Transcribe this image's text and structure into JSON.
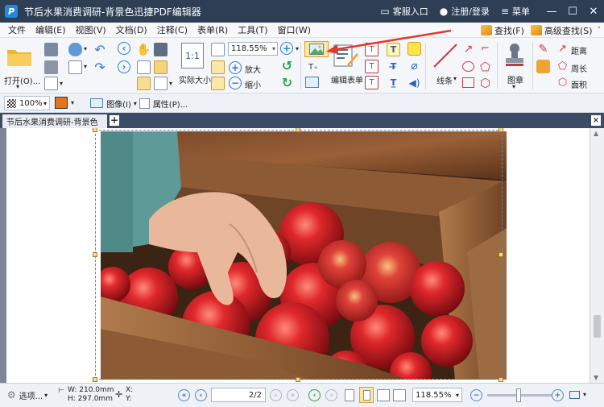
{
  "titlebar": {
    "app_icon": "P",
    "title": "节后水果消费调研-背景色迅捷PDF编辑器",
    "links": [
      {
        "icon": "chat-icon",
        "label": "客服入口"
      },
      {
        "icon": "user-icon",
        "label": "注册/登录"
      },
      {
        "icon": "menu-icon",
        "label": "菜单"
      }
    ]
  },
  "menubar": {
    "items": [
      "文件",
      "编辑(E)",
      "视图(V)",
      "文档(D)",
      "注释(C)",
      "表单(R)",
      "工具(T)",
      "窗口(W)"
    ],
    "find": "查找(F)",
    "advanced_find": "高级查找(S)"
  },
  "ribbon": {
    "open_label": "打开(O)...",
    "zoom_value": "118.55%",
    "actual_size": "实际大小",
    "zoom_in": "放大",
    "zoom_out": "缩小",
    "edit_form": "编辑表单",
    "line_tool": "线条",
    "stamp": "图章",
    "distance": "距离",
    "perimeter": "周长",
    "area": "面积"
  },
  "toolbar2": {
    "zoom_value": "100%",
    "image_label": "图像(I)",
    "properties_label": "属性(P)..."
  },
  "tabs": {
    "active_tab": "节后水果消费调研-背景色",
    "add": "+",
    "close": "×"
  },
  "statusbar": {
    "options_label": "选项...",
    "width": "W: 210.0mm",
    "height": "H: 297.0mm",
    "x_label": "X:",
    "y_label": "Y:",
    "page_indicator": "2/2",
    "zoom_value": "118.55%"
  },
  "colors": {
    "titlebar": "#2d3e55",
    "tabbar": "#3b4c66",
    "accent_blue": "#2e7bd6",
    "annotation_arrow": "#e23b2e"
  }
}
